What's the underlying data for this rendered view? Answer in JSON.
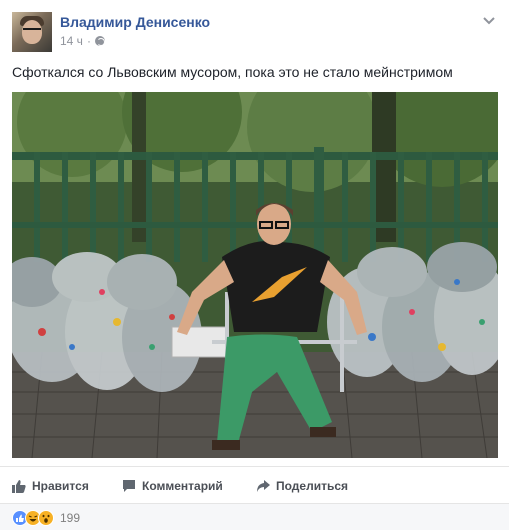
{
  "post": {
    "author": "Владимир Денисенко",
    "time": "14 ч",
    "separator": "·",
    "privacy_icon": "globe-icon",
    "menu_icon": "chevron-down-icon",
    "text": "Сфоткался со Львовским мусором, пока это не стало мейнстримом"
  },
  "actions": {
    "like_label": "Нравится",
    "comment_label": "Комментарий",
    "share_label": "Поделиться"
  },
  "reactions": {
    "icons": [
      "like-reaction-icon",
      "haha-reaction-icon",
      "wow-reaction-icon"
    ],
    "count": "199"
  },
  "colors": {
    "link": "#365899",
    "meta": "#90949c",
    "action": "#4b4f56",
    "like": "#5890ff",
    "haha": "#f7b125"
  }
}
